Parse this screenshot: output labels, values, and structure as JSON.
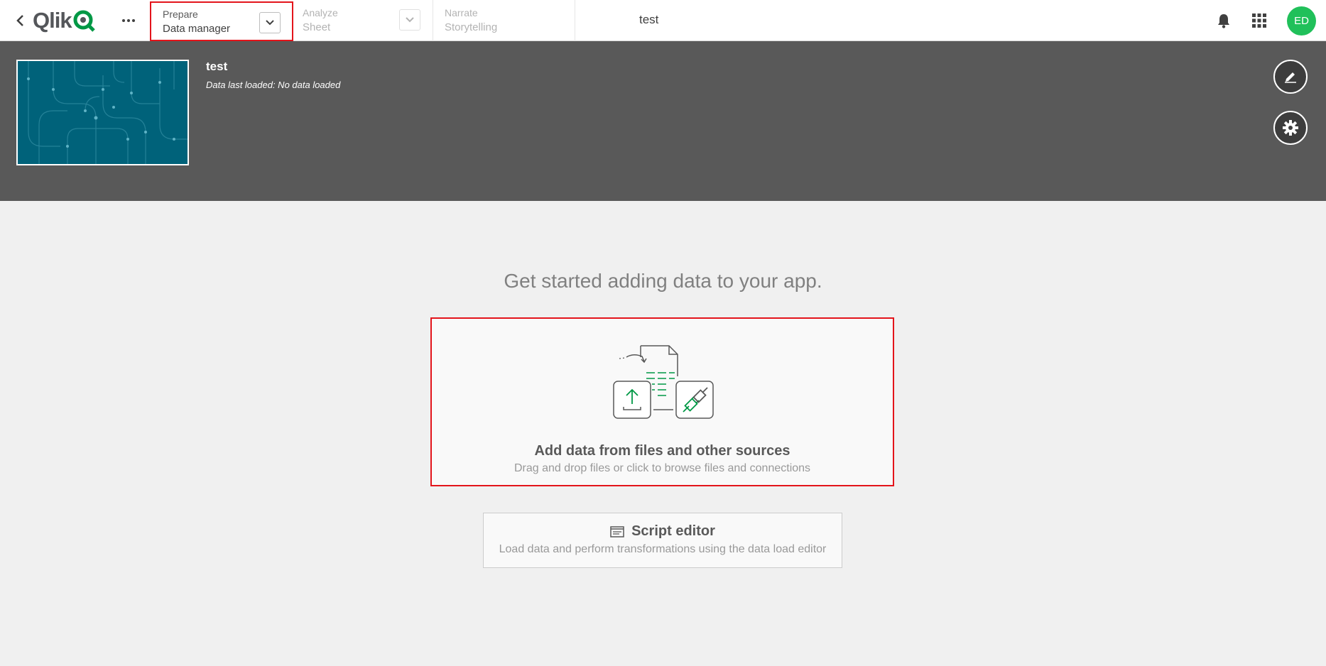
{
  "logo": {
    "text": "Qlik"
  },
  "nav": {
    "prepare": {
      "label": "Prepare",
      "value": "Data manager"
    },
    "analyze": {
      "label": "Analyze",
      "value": "Sheet"
    },
    "narrate": {
      "label": "Narrate",
      "value": "Storytelling"
    }
  },
  "app": {
    "title": "test"
  },
  "user": {
    "initials": "ED"
  },
  "header": {
    "title": "test",
    "subtitle": "Data last loaded: No data loaded"
  },
  "main": {
    "heading": "Get started adding data to your app.",
    "add_data": {
      "title": "Add data from files and other sources",
      "subtitle": "Drag and drop files or click to browse files and connections"
    },
    "script_editor": {
      "title": "Script editor",
      "subtitle": "Load data and perform transformations using the data load editor"
    }
  },
  "colors": {
    "brand_green": "#009845",
    "avatar": "#20c05a",
    "highlight": "#e3141b",
    "header_bg": "#595959",
    "thumb_bg": "#00627a"
  },
  "icons": [
    "chevron-left-icon",
    "more-icon",
    "chevron-down-icon",
    "bell-icon",
    "apps-grid-icon",
    "pencil-icon",
    "gear-icon",
    "upload-icon",
    "connector-icon",
    "script-icon"
  ]
}
